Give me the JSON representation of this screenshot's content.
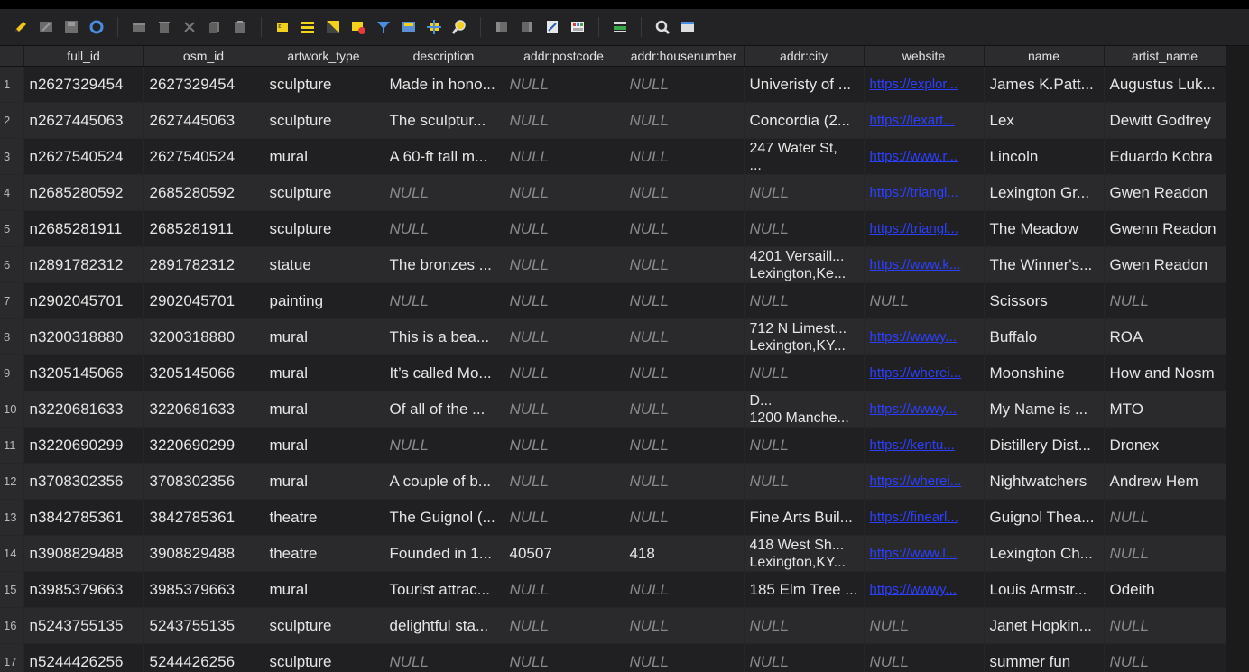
{
  "toolbar": {
    "icons": [
      "pencil-icon",
      "multi-edit-icon",
      "save-icon",
      "refresh-icon",
      "add-row-icon",
      "delete-row-icon",
      "cut-icon",
      "copy-icon",
      "paste-icon",
      "select-expression-icon",
      "select-all-icon",
      "invert-selection-icon",
      "deselect-icon",
      "filter-icon",
      "move-selection-top-icon",
      "pan-to-selection-icon",
      "zoom-to-selection-icon",
      "new-field-icon",
      "delete-field-icon",
      "field-calculator-icon",
      "conditional-formatting-icon",
      "dock-icon",
      "actions-icon",
      "table-view-icon"
    ]
  },
  "table": {
    "columns": [
      "full_id",
      "osm_id",
      "artwork_type",
      "description",
      "addr:postcode",
      "addr:housenumber",
      "addr:city",
      "website",
      "name",
      "artist_name"
    ],
    "rows": [
      {
        "n": "1",
        "full_id": "n2627329454",
        "osm_id": "2627329454",
        "artwork_type": "sculpture",
        "description": "Made in hono...",
        "postcode": "NULL",
        "housenumber": "NULL",
        "city": "Univeristy of ...",
        "website": "https://explor...",
        "name": "James K.Patt...",
        "artist": "Augustus Luk..."
      },
      {
        "n": "2",
        "full_id": "n2627445063",
        "osm_id": "2627445063",
        "artwork_type": "sculpture",
        "description": "The sculptur...",
        "postcode": "NULL",
        "housenumber": "NULL",
        "city": "Concordia (2...",
        "website": "https://lexart...",
        "name": "Lex",
        "artist": "Dewitt Godfrey"
      },
      {
        "n": "3",
        "full_id": "n2627540524",
        "osm_id": "2627540524",
        "artwork_type": "mural",
        "description": "A 60-ft tall m...",
        "postcode": "NULL",
        "housenumber": "NULL",
        "city": "247 Water St,\n...",
        "website": "https://www.r...",
        "name": "Lincoln",
        "artist": "Eduardo Kobra"
      },
      {
        "n": "4",
        "full_id": "n2685280592",
        "osm_id": "2685280592",
        "artwork_type": "sculpture",
        "description": "NULL",
        "postcode": "NULL",
        "housenumber": "NULL",
        "city": "NULL",
        "website": "https://triangl...",
        "name": "Lexington Gr...",
        "artist": "Gwen Readon"
      },
      {
        "n": "5",
        "full_id": "n2685281911",
        "osm_id": "2685281911",
        "artwork_type": "sculpture",
        "description": "NULL",
        "postcode": "NULL",
        "housenumber": "NULL",
        "city": "NULL",
        "website": "https://triangl...",
        "name": "The Meadow",
        "artist": "Gwenn Readon"
      },
      {
        "n": "6",
        "full_id": "n2891782312",
        "osm_id": "2891782312",
        "artwork_type": "statue",
        "description": "The bronzes ...",
        "postcode": "NULL",
        "housenumber": "NULL",
        "city": "4201 Versaill...\nLexington,Ke...",
        "website": "https://www.k...",
        "name": "The Winner's...",
        "artist": "Gwen Readon"
      },
      {
        "n": "7",
        "full_id": "n2902045701",
        "osm_id": "2902045701",
        "artwork_type": "painting",
        "description": "NULL",
        "postcode": "NULL",
        "housenumber": "NULL",
        "city": "NULL",
        "website": "NULL",
        "name": "Scissors",
        "artist": "NULL"
      },
      {
        "n": "8",
        "full_id": "n3200318880",
        "osm_id": "3200318880",
        "artwork_type": "mural",
        "description": "This is a bea...",
        "postcode": "NULL",
        "housenumber": "NULL",
        "city": "712 N Limest...\nLexington,KY...",
        "website": "https://wwwy...",
        "name": "Buffalo",
        "artist": "ROA"
      },
      {
        "n": "9",
        "full_id": "n3205145066",
        "osm_id": "3205145066",
        "artwork_type": "mural",
        "description": "It’s called Mo...",
        "postcode": "NULL",
        "housenumber": "NULL",
        "city": "NULL",
        "website": "https://wherei...",
        "name": "Moonshine",
        "artist": "How and Nosm"
      },
      {
        "n": "10",
        "full_id": "n3220681633",
        "osm_id": "3220681633",
        "artwork_type": "mural",
        "description": "Of all of the ...",
        "postcode": "NULL",
        "housenumber": "NULL",
        "city": "D...\n1200 Manche...",
        "website": "https://wwwy...",
        "name": "My Name is ...",
        "artist": "MTO"
      },
      {
        "n": "11",
        "full_id": "n3220690299",
        "osm_id": "3220690299",
        "artwork_type": "mural",
        "description": "NULL",
        "postcode": "NULL",
        "housenumber": "NULL",
        "city": "NULL",
        "website": "https://kentu...",
        "name": "Distillery Dist...",
        "artist": "Dronex"
      },
      {
        "n": "12",
        "full_id": "n3708302356",
        "osm_id": "3708302356",
        "artwork_type": "mural",
        "description": "A couple of b...",
        "postcode": "NULL",
        "housenumber": "NULL",
        "city": "NULL",
        "website": "https://wherei...",
        "name": "Nightwatchers",
        "artist": "Andrew Hem"
      },
      {
        "n": "13",
        "full_id": "n3842785361",
        "osm_id": "3842785361",
        "artwork_type": "theatre",
        "description": "The Guignol (...",
        "postcode": "NULL",
        "housenumber": "NULL",
        "city": "Fine Arts Buil...",
        "website": "https://finearl...",
        "name": "Guignol Thea...",
        "artist": "NULL"
      },
      {
        "n": "14",
        "full_id": "n3908829488",
        "osm_id": "3908829488",
        "artwork_type": "theatre",
        "description": "Founded in 1...",
        "postcode": "40507",
        "housenumber": "418",
        "city": "418 West Sh...\nLexington,KY...",
        "website": "https://www.l...",
        "name": "Lexington Ch...",
        "artist": "NULL"
      },
      {
        "n": "15",
        "full_id": "n3985379663",
        "osm_id": "3985379663",
        "artwork_type": "mural",
        "description": "Tourist attrac...",
        "postcode": "NULL",
        "housenumber": "NULL",
        "city": "185 Elm Tree ...",
        "website": "https://wwwy...",
        "name": "Louis Armstr...",
        "artist": "Odeith"
      },
      {
        "n": "16",
        "full_id": "n5243755135",
        "osm_id": "5243755135",
        "artwork_type": "sculpture",
        "description": "delightful sta...",
        "postcode": "NULL",
        "housenumber": "NULL",
        "city": "NULL",
        "website": "NULL",
        "name": "Janet Hopkin...",
        "artist": "NULL"
      },
      {
        "n": "17",
        "full_id": "n5244426256",
        "osm_id": "5244426256",
        "artwork_type": "sculpture",
        "description": "NULL",
        "postcode": "NULL",
        "housenumber": "NULL",
        "city": "NULL",
        "website": "NULL",
        "name": "summer fun",
        "artist": "NULL"
      }
    ]
  }
}
